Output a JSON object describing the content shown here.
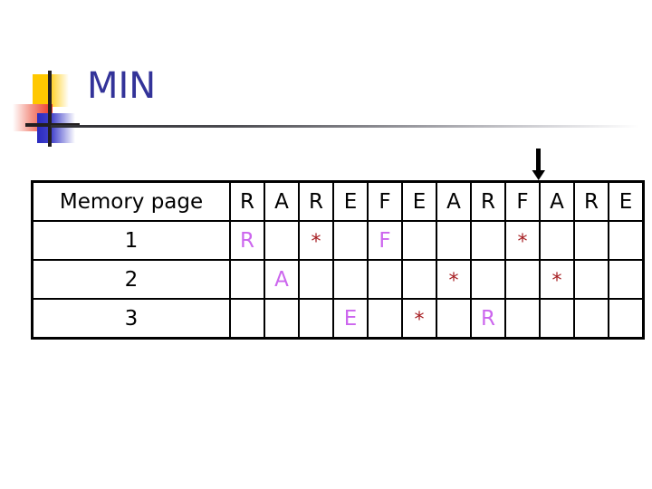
{
  "slide": {
    "title": "MIN",
    "title_color": "#333399",
    "rule_color": "#2e2e33"
  },
  "logo": {
    "yellow": "#FFC800",
    "red": "#EE3322",
    "blue": "#2A2ABF",
    "cross": "#231f20"
  },
  "arrow": {
    "name": "down-arrow-marker",
    "points_at_column_index": 10,
    "color": "#000000"
  },
  "table": {
    "row_label_header": "Memory page",
    "reference_string": [
      "R",
      "A",
      "R",
      "E",
      "F",
      "E",
      "A",
      "R",
      "F",
      "A",
      "R",
      "E"
    ],
    "letter_color": "#CC66EE",
    "star_color": "#A61D21",
    "star_glyph": "*",
    "rows": [
      {
        "label": "1",
        "cells": [
          "R",
          "",
          "*",
          "",
          "F",
          "",
          "",
          "",
          "*",
          "",
          "",
          ""
        ]
      },
      {
        "label": "2",
        "cells": [
          "",
          "A",
          "",
          "",
          "",
          "",
          "*",
          "",
          "",
          "*",
          "",
          ""
        ]
      },
      {
        "label": "3",
        "cells": [
          "",
          "",
          "",
          "E",
          "",
          "*",
          "",
          "R",
          "",
          "",
          "",
          ""
        ]
      }
    ]
  }
}
